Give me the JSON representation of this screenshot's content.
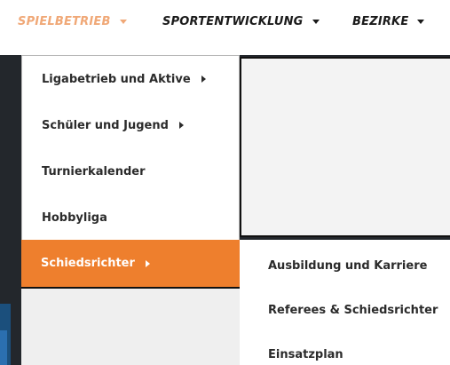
{
  "topnav": {
    "items": [
      {
        "label": "SPIELBETRIEB"
      },
      {
        "label": "SPORTENTWICKLUNG"
      },
      {
        "label": "BEZIRKE"
      }
    ]
  },
  "dropdown": {
    "items": [
      {
        "label": "Ligabetrieb und Aktive"
      },
      {
        "label": "Schüler und Jugend"
      },
      {
        "label": "Turnierkalender"
      },
      {
        "label": "Hobbyliga"
      },
      {
        "label": "Schiedsrichter"
      }
    ]
  },
  "submenu": {
    "items": [
      {
        "label": "Ausbildung und Karriere"
      },
      {
        "label": "Referees & Schiedsrichter"
      },
      {
        "label": "Einsatzplan"
      }
    ]
  },
  "colors": {
    "accent": "#ee7f2d",
    "active_nav": "#f0a877",
    "background_dark": "#23272c"
  }
}
